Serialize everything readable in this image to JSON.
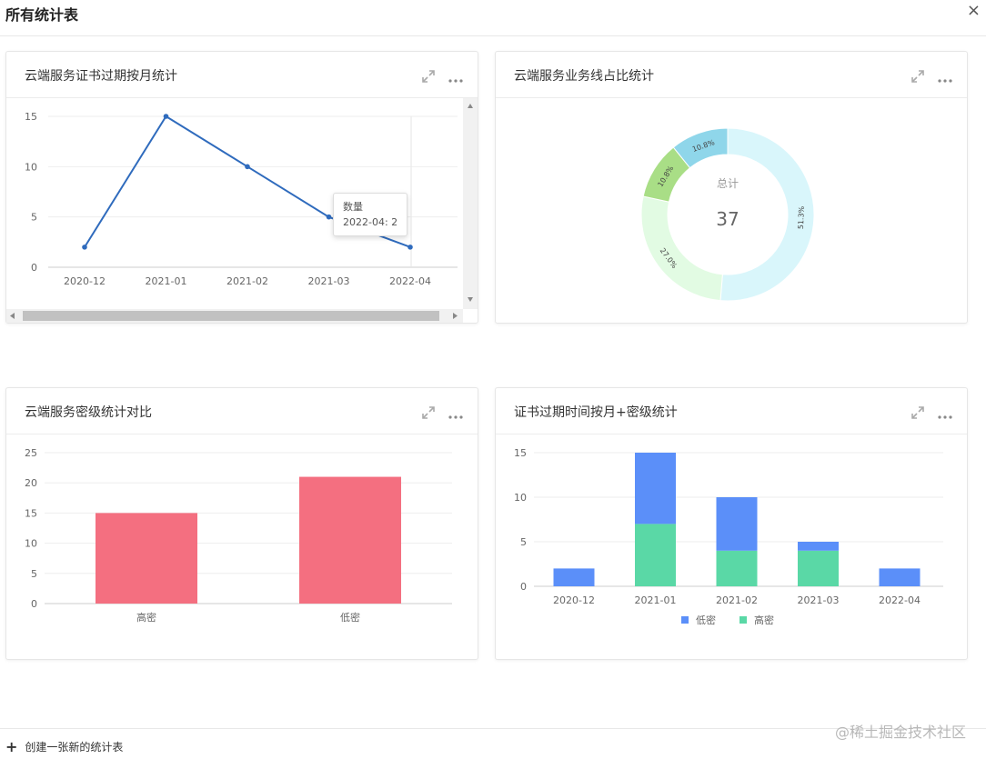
{
  "header": {
    "title": "所有统计表",
    "close_label": "×"
  },
  "footer": {
    "add_label": "创建一张新的统计表",
    "watermark": "@稀土掘金技术社区"
  },
  "colors": {
    "line": "#2f6bbd",
    "pie": [
      "#d9f6fb",
      "#e2fbe3",
      "#a9de86",
      "#8fd6ea"
    ],
    "bar": "#f46f80",
    "low": "#5b8ff9",
    "high": "#5ad8a6"
  },
  "cards": {
    "expiry": {
      "title": "云端服务证书过期按月统计"
    },
    "bizline": {
      "title": "云端服务业务线占比统计"
    },
    "secret": {
      "title": "云端服务密级统计对比"
    },
    "combo": {
      "title": "证书过期时间按月+密级统计"
    }
  },
  "chart_data": [
    {
      "type": "line",
      "categories": [
        "2020-12",
        "2021-01",
        "2021-02",
        "2021-03",
        "2022-04"
      ],
      "series": [
        {
          "name": "数量",
          "values": [
            2,
            15,
            10,
            5,
            2
          ]
        }
      ],
      "ylim": [
        0,
        15
      ],
      "yticks": [
        "0",
        "5",
        "10",
        "15"
      ],
      "tooltip": {
        "label": "数量",
        "text": "2022-04: 2"
      }
    },
    {
      "type": "pie",
      "donut": true,
      "values": [
        51.3,
        27.0,
        10.8,
        10.8
      ],
      "labels": [
        "51.3%",
        "27.0%",
        "10.8%",
        "10.8%"
      ],
      "center_label": "总计",
      "center_value": "37"
    },
    {
      "type": "bar",
      "categories": [
        "高密",
        "低密"
      ],
      "values": [
        15,
        21
      ],
      "ylim": [
        0,
        25
      ],
      "yticks": [
        "0",
        "5",
        "10",
        "15",
        "20",
        "25"
      ]
    },
    {
      "type": "bar",
      "stacked": true,
      "categories": [
        "2020-12",
        "2021-01",
        "2021-02",
        "2021-03",
        "2022-04"
      ],
      "series": [
        {
          "name": "低密",
          "values": [
            2,
            8,
            6,
            1,
            2
          ]
        },
        {
          "name": "高密",
          "values": [
            0,
            7,
            4,
            4,
            0
          ]
        }
      ],
      "ylim": [
        0,
        15
      ],
      "yticks": [
        "0",
        "5",
        "10",
        "15"
      ],
      "legend": "bottom"
    }
  ]
}
